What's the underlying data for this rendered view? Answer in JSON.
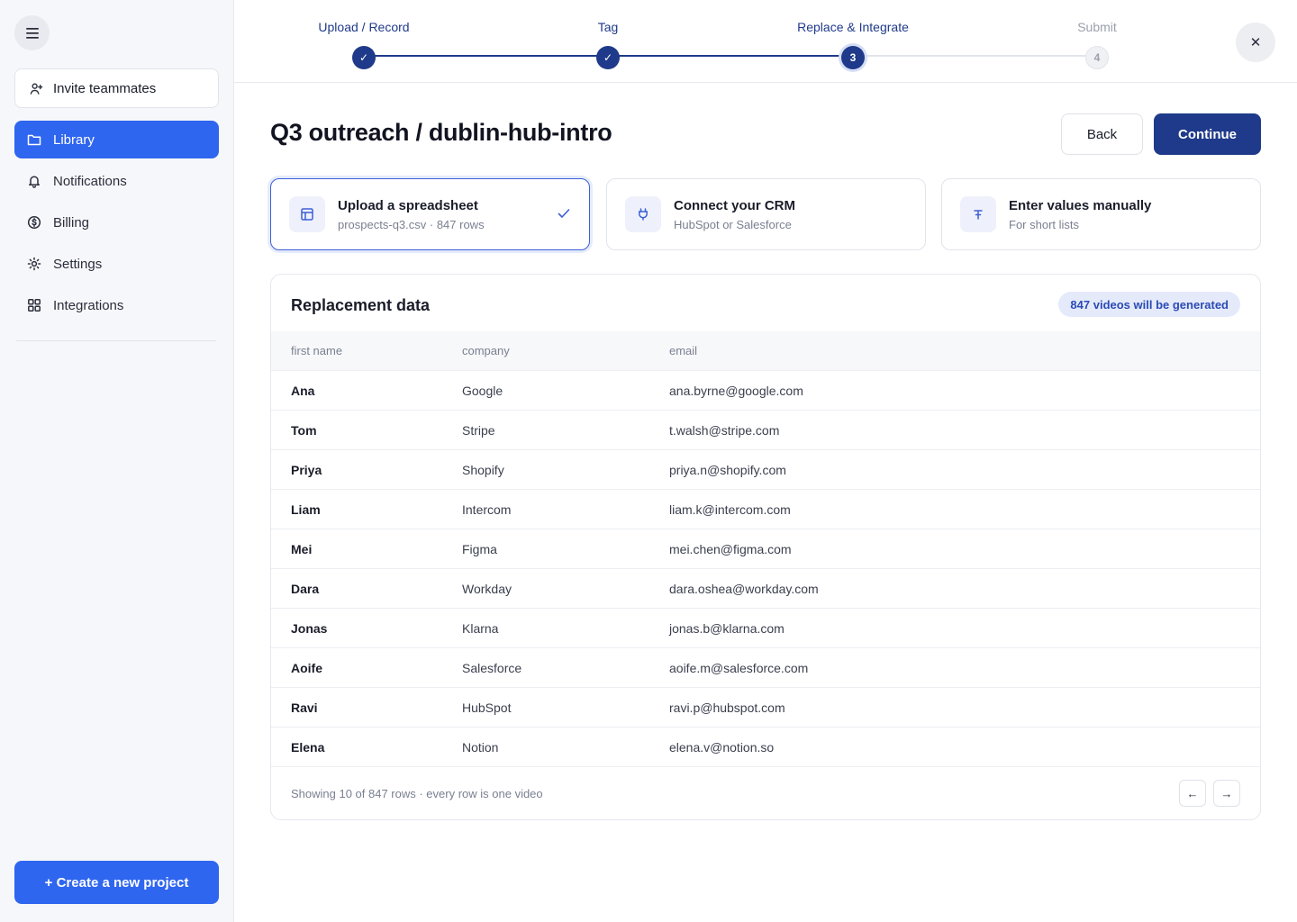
{
  "sidebar": {
    "menu_icon": "hamburger-icon",
    "invite_label": "Invite teammates",
    "items": [
      {
        "label": "Library",
        "icon": "folder-icon",
        "active": true
      },
      {
        "label": "Notifications",
        "icon": "bell-icon"
      },
      {
        "label": "Billing",
        "icon": "dollar-icon"
      },
      {
        "label": "Settings",
        "icon": "sun-gear-icon"
      },
      {
        "label": "Integrations",
        "icon": "grid-icon"
      }
    ],
    "create_label": "+ Create a new project"
  },
  "stepper": {
    "steps": [
      {
        "label": "Upload / Record",
        "status": "done",
        "marker": "✓"
      },
      {
        "label": "Tag",
        "status": "done",
        "marker": "✓"
      },
      {
        "label": "Replace & Integrate",
        "status": "current",
        "marker": "3"
      },
      {
        "label": "Submit",
        "status": "todo",
        "marker": "4"
      }
    ],
    "close_glyph": "✕"
  },
  "header": {
    "title": "Q3 outreach / dublin-hub-intro",
    "back_label": "Back",
    "continue_label": "Continue"
  },
  "options": [
    {
      "title": "Upload a spreadsheet",
      "subtitle": "prospects-q3.csv · 847 rows",
      "selected": true,
      "icon": "table-icon"
    },
    {
      "title": "Connect your CRM",
      "subtitle": "HubSpot or Salesforce",
      "selected": false,
      "icon": "plug-icon"
    },
    {
      "title": "Enter values manually",
      "subtitle": "For short lists",
      "selected": false,
      "icon": "text-cursor-icon"
    }
  ],
  "table": {
    "title": "Replacement data",
    "badge": "847 videos will be generated",
    "columns": [
      "first name",
      "company",
      "email"
    ],
    "rows": [
      [
        "Ana",
        "Google",
        "ana.byrne@google.com"
      ],
      [
        "Tom",
        "Stripe",
        "t.walsh@stripe.com"
      ],
      [
        "Priya",
        "Shopify",
        "priya.n@shopify.com"
      ],
      [
        "Liam",
        "Intercom",
        "liam.k@intercom.com"
      ],
      [
        "Mei",
        "Figma",
        "mei.chen@figma.com"
      ],
      [
        "Dara",
        "Workday",
        "dara.oshea@workday.com"
      ],
      [
        "Jonas",
        "Klarna",
        "jonas.b@klarna.com"
      ],
      [
        "Aoife",
        "Salesforce",
        "aoife.m@salesforce.com"
      ],
      [
        "Ravi",
        "HubSpot",
        "ravi.p@hubspot.com"
      ],
      [
        "Elena",
        "Notion",
        "elena.v@notion.so"
      ]
    ],
    "footer": "Showing 10 of 847 rows · every row is one video",
    "prev_glyph": "←",
    "next_glyph": "→"
  },
  "colors": {
    "primary": "#2f66f0",
    "navy": "#1f3a8a",
    "sidebar_bg": "#f6f7fa"
  }
}
